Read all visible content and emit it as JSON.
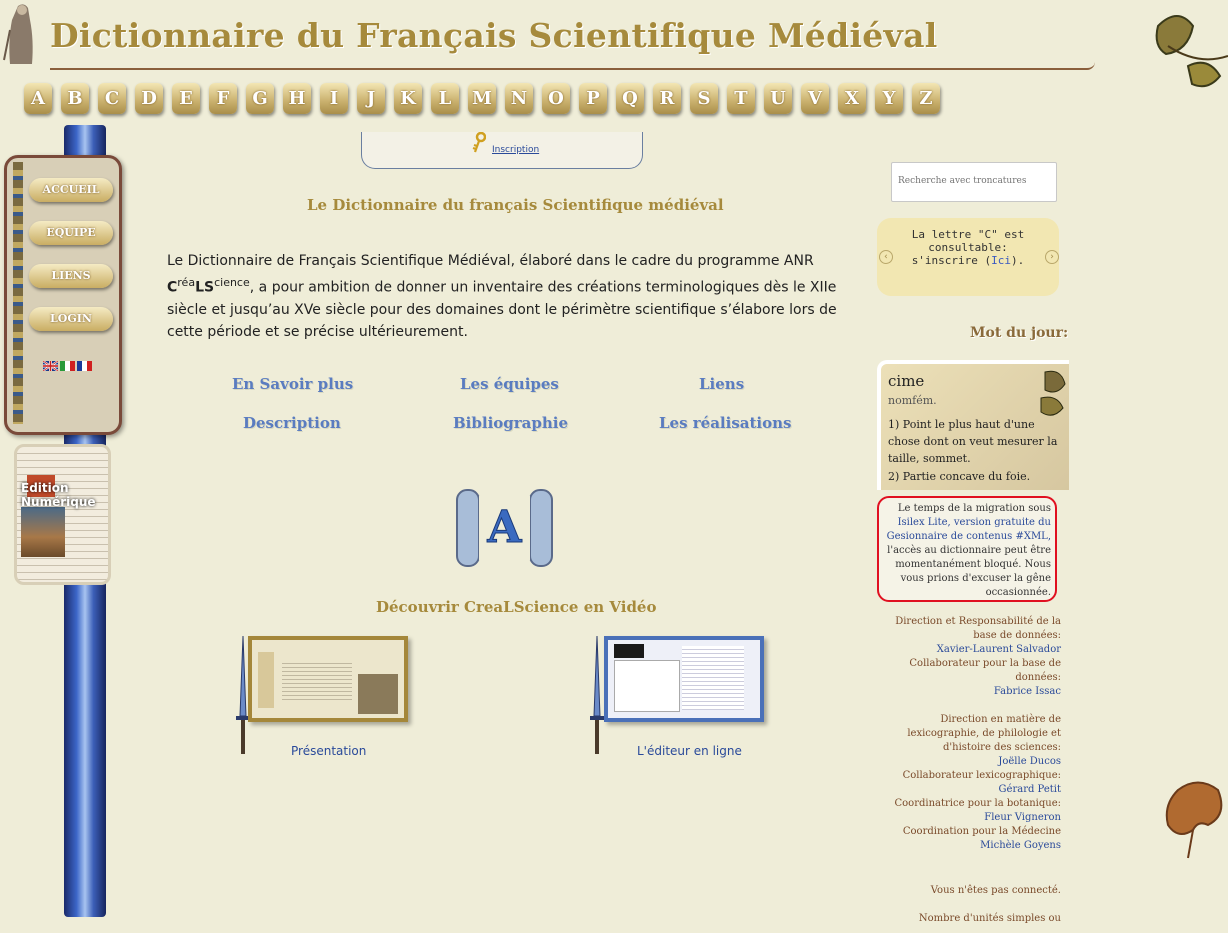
{
  "site_title": "Dictionnaire du Français Scientifique Médiéval",
  "alphabet": [
    "A",
    "B",
    "C",
    "D",
    "E",
    "F",
    "G",
    "H",
    "I",
    "J",
    "K",
    "L",
    "M",
    "N",
    "O",
    "P",
    "Q",
    "R",
    "S",
    "T",
    "U",
    "V",
    "X",
    "Y",
    "Z"
  ],
  "menu": {
    "accueil": "ACCUEIL",
    "equipe": "EQUIPE",
    "liens": "LIENS",
    "login": "LOGIN"
  },
  "edition_label": "Edition Numérique",
  "inscription_label": "Inscription",
  "main": {
    "heading": "Le Dictionnaire du français Scientifique médiéval",
    "intro_before": "Le Dictionnaire de Français Scientifique Médiéval, élaboré dans le cadre du programme ANR ",
    "intro_c": "C",
    "intro_rea": "réa",
    "intro_ls": "LS",
    "intro_cience": "cience",
    "intro_after": ", a pour ambition de donner un inventaire des créations terminologiques dès le XIIe siècle et jusqu’au XVe siècle pour des domaines dont le périmètre scientifique s’élabore lors de cette période et se précise ultérieurement.",
    "links": {
      "en_savoir_plus": "En Savoir plus",
      "les_equipes": "Les équipes",
      "liens": "Liens",
      "description": "Description",
      "bibliographie": "Bibliographie",
      "les_realisations": "Les réalisations"
    },
    "big_letter": "A",
    "video_heading": "Découvrir CreaLScience en Vidéo",
    "videos": {
      "presentation": "Présentation",
      "editeur": "L'éditeur en ligne"
    }
  },
  "sidebar": {
    "search_placeholder": "Recherche avec troncatures",
    "notice_text": "La lettre \"C\" est consultable: s'inscrire (",
    "notice_link": "Ici",
    "notice_end": ").",
    "mot_du_jour_heading": "Mot du jour:",
    "mot_du_jour": {
      "word": "cime",
      "pos": "nomfém.",
      "def1": "1)  Point le plus haut d'une chose dont on veut mesurer la taille, sommet.",
      "def2": "2)  Partie concave du foie."
    },
    "migration": {
      "p1": "Le temps de la migration sous",
      "l1": "Isilex Lite, version gratuite du Gesionnaire de contenus #XML,",
      "p2": "l'accès au dictionnaire peut être momentanément bloqué. Nous vous prions d'excuser la gêne occasionnée."
    },
    "credits": [
      {
        "role": "Direction et Responsabilité de la base de données:",
        "name": "Xavier-Laurent Salvador"
      },
      {
        "role": "Collaborateur pour la base de données:",
        "name": "Fabrice Issac"
      },
      {
        "role": "Direction en matière de lexicographie, de philologie et d'histoire des sciences:",
        "name": "Joëlle Ducos"
      },
      {
        "role": "Collaborateur lexicographique:",
        "name": "Gérard Petit"
      },
      {
        "role": "Coordinatrice pour la botanique:",
        "name": "Fleur Vigneron"
      },
      {
        "role": "Coordination pour la Médecine",
        "name": "Michèle Goyens"
      }
    ],
    "status": "Vous n'êtes pas connecté.",
    "units": "Nombre d'unités simples ou"
  },
  "colors": {
    "gold": "#a68a3c",
    "link_blue": "#5a7cc0",
    "alert_red": "#e01020"
  }
}
